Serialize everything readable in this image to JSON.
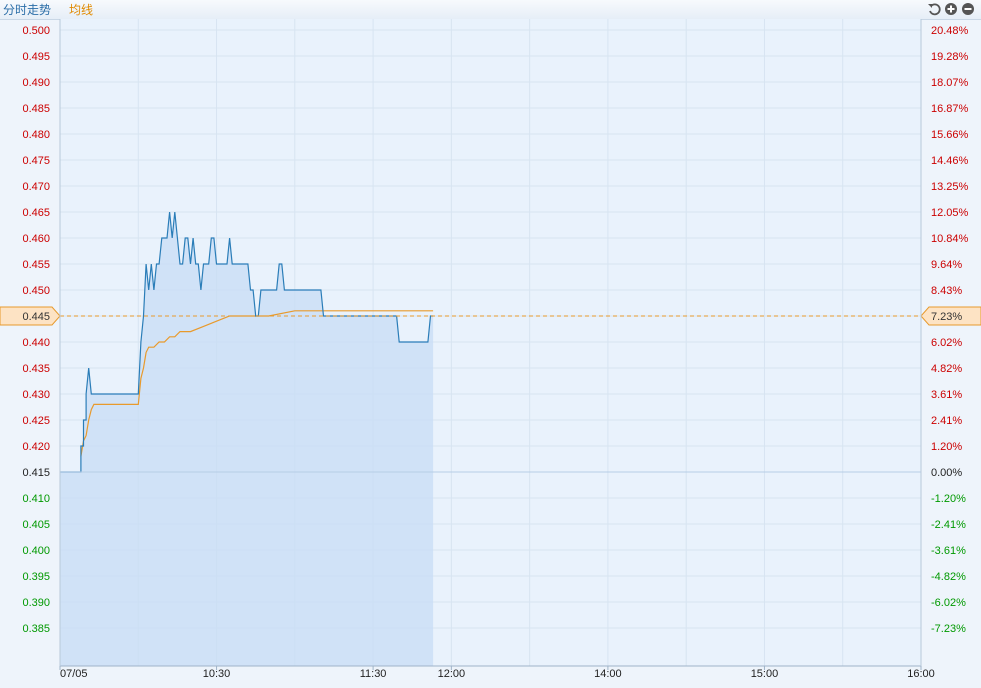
{
  "header": {
    "tab_trend": "分时走势",
    "tab_avg": "均线",
    "tab_trend_color": "#2b6ea8",
    "tab_avg_color": "#e08a00",
    "tools": [
      "refresh-icon",
      "zoom-in-icon",
      "zoom-out-icon"
    ]
  },
  "chart_data": {
    "type": "area",
    "date": "07/05",
    "prev_close": 0.415,
    "current": {
      "price_label": "0.445",
      "pct_label": "7.23%"
    },
    "colors": {
      "price_line": "#2a7db8",
      "avg_line": "#e89a2c",
      "area_fill": "#c9ddf5",
      "up": "#cc0000",
      "down": "#009900",
      "flat": "#222222",
      "grid": "#d7e4f1",
      "current_marker": "#fde3c4"
    },
    "left_axis": {
      "ticks": [
        "0.500",
        "0.495",
        "0.490",
        "0.485",
        "0.480",
        "0.475",
        "0.470",
        "0.465",
        "0.460",
        "0.455",
        "0.450",
        "0.445",
        "0.440",
        "0.435",
        "0.430",
        "0.425",
        "0.420",
        "0.415",
        "0.410",
        "0.405",
        "0.400",
        "0.395",
        "0.390",
        "0.385"
      ],
      "ylim": [
        0.38,
        0.5
      ]
    },
    "right_axis": {
      "ticks": [
        "20.48%",
        "19.28%",
        "18.07%",
        "16.87%",
        "15.66%",
        "14.46%",
        "13.25%",
        "12.05%",
        "10.84%",
        "9.64%",
        "8.43%",
        "7.23%",
        "6.02%",
        "4.82%",
        "3.61%",
        "2.41%",
        "1.20%",
        "0.00%",
        "-1.20%",
        "-2.41%",
        "-3.61%",
        "-4.82%",
        "-6.02%",
        "-7.23%"
      ]
    },
    "x_axis": {
      "session_minutes": 330,
      "ticks": [
        {
          "label": "07/05",
          "minute": 0
        },
        {
          "label": "10:30",
          "minute": 60
        },
        {
          "label": "11:30",
          "minute": 120
        },
        {
          "label": "12:00",
          "minute": 150
        },
        {
          "label": "14:00",
          "minute": 210
        },
        {
          "label": "15:00",
          "minute": 270
        },
        {
          "label": "16:00",
          "minute": 330
        }
      ]
    },
    "price_series": {
      "name": "分时走势",
      "x": [
        0,
        8,
        8,
        9,
        9,
        10,
        10,
        11,
        12,
        13,
        14,
        14,
        15,
        15,
        16,
        17,
        18,
        19,
        20,
        30,
        31,
        31,
        32,
        33,
        34,
        35,
        36,
        37,
        38,
        39,
        40,
        41,
        42,
        43,
        44,
        45,
        46,
        47,
        48,
        49,
        50,
        51,
        52,
        53,
        54,
        55,
        56,
        57,
        58,
        59,
        60,
        61,
        62,
        63,
        64,
        65,
        66,
        67,
        68,
        69,
        70,
        71,
        72,
        73,
        74,
        75,
        76,
        77,
        78,
        79,
        80,
        81,
        82,
        83,
        84,
        85,
        86,
        87,
        88,
        89,
        90,
        91,
        92,
        93,
        94,
        95,
        96,
        97,
        98,
        99,
        100,
        101,
        102,
        103,
        104,
        105,
        106,
        107,
        108,
        109,
        110,
        111,
        112,
        113,
        114,
        115,
        116,
        117,
        118,
        119,
        120,
        121,
        122,
        123,
        124,
        125,
        126,
        127,
        128,
        129,
        130,
        131,
        132,
        133,
        134,
        135,
        136,
        137,
        138,
        139,
        140,
        141,
        142,
        143
      ],
      "values": [
        0.415,
        0.415,
        0.42,
        0.42,
        0.425,
        0.425,
        0.43,
        0.435,
        0.43,
        0.43,
        0.43,
        0.43,
        0.43,
        0.43,
        0.43,
        0.43,
        0.43,
        0.43,
        0.43,
        0.43,
        0.44,
        0.44,
        0.445,
        0.455,
        0.45,
        0.455,
        0.45,
        0.455,
        0.455,
        0.46,
        0.46,
        0.46,
        0.465,
        0.46,
        0.465,
        0.46,
        0.455,
        0.455,
        0.46,
        0.46,
        0.455,
        0.46,
        0.455,
        0.455,
        0.45,
        0.455,
        0.455,
        0.455,
        0.46,
        0.46,
        0.455,
        0.455,
        0.455,
        0.455,
        0.455,
        0.46,
        0.455,
        0.455,
        0.455,
        0.455,
        0.455,
        0.455,
        0.455,
        0.45,
        0.45,
        0.445,
        0.445,
        0.45,
        0.45,
        0.45,
        0.45,
        0.45,
        0.45,
        0.45,
        0.455,
        0.455,
        0.45,
        0.45,
        0.45,
        0.45,
        0.45,
        0.45,
        0.45,
        0.45,
        0.45,
        0.45,
        0.45,
        0.45,
        0.45,
        0.45,
        0.45,
        0.445,
        0.445,
        0.445,
        0.445,
        0.445,
        0.445,
        0.445,
        0.445,
        0.445,
        0.445,
        0.445,
        0.445,
        0.445,
        0.445,
        0.445,
        0.445,
        0.445,
        0.445,
        0.445,
        0.445,
        0.445,
        0.445,
        0.445,
        0.445,
        0.445,
        0.445,
        0.445,
        0.445,
        0.445,
        0.44,
        0.44,
        0.44,
        0.44,
        0.44,
        0.44,
        0.44,
        0.44,
        0.44,
        0.44,
        0.44,
        0.44,
        0.445,
        0.445
      ]
    },
    "avg_series": {
      "name": "均线",
      "x": [
        8,
        9,
        10,
        11,
        12,
        13,
        14,
        20,
        30,
        31,
        32,
        33,
        34,
        36,
        38,
        40,
        42,
        44,
        46,
        48,
        50,
        55,
        60,
        65,
        70,
        75,
        80,
        90,
        100,
        110,
        120,
        130,
        143
      ],
      "values": [
        0.418,
        0.421,
        0.422,
        0.425,
        0.427,
        0.428,
        0.428,
        0.428,
        0.428,
        0.433,
        0.435,
        0.438,
        0.439,
        0.439,
        0.44,
        0.44,
        0.441,
        0.441,
        0.442,
        0.442,
        0.442,
        0.443,
        0.444,
        0.445,
        0.445,
        0.445,
        0.445,
        0.446,
        0.446,
        0.446,
        0.446,
        0.446,
        0.446
      ]
    }
  }
}
